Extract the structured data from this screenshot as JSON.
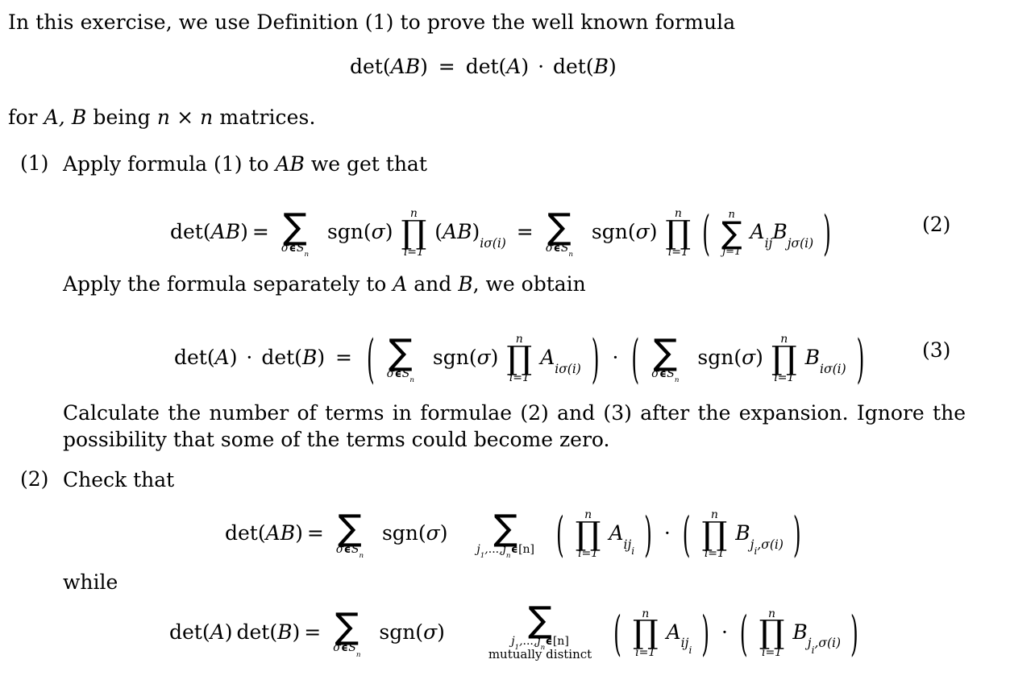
{
  "document": {
    "intro": {
      "line1": "In this exercise, we use Definition (1) to prove the well known formula",
      "display_formula": "det(AB) = det(A) · det(B)",
      "line2_prefix": "for ",
      "line2_vars": "A, B",
      "line2_mid": " being ",
      "line2_dims": "n × n",
      "line2_suffix": " matrices."
    },
    "items": [
      {
        "marker": "(1)",
        "text": "Apply formula (1) to AB we get that",
        "text_prefix": "Apply formula (1) to ",
        "text_math": "AB",
        "text_suffix": " we get that",
        "equation_number": "(2)",
        "equation_latex": "det(AB) = \\sum_{\\sigma \\in S_n} sgn(\\sigma) \\prod_{i=1}^{n} (AB)_{i\\sigma(i)} = \\sum_{\\sigma \\in S_n} sgn(\\sigma) \\prod_{i=1}^{n} \\left( \\sum_{j=1}^{n} A_{ij} B_{j\\sigma(i)} \\right)",
        "sub_text_prefix": "Apply the formula separately to ",
        "sub_text_a": "A",
        "sub_text_mid": " and ",
        "sub_text_b": "B",
        "sub_text_suffix": ", we obtain",
        "equation_number_2": "(3)",
        "equation_latex_2": "det(A) \\cdot det(B) = \\left( \\sum_{\\sigma \\in S_n} sgn(\\sigma) \\prod_{i=1}^{n} A_{i\\sigma(i)} \\right) \\cdot \\left( \\sum_{\\sigma \\in S_n} sgn(\\sigma) \\prod_{i=1}^{n} B_{i\\sigma(i)} \\right)",
        "closing_paragraph": "Calculate the number of terms in formulae (2) and (3) after the expansion. Ignore the possibility that some of the terms could become zero."
      },
      {
        "marker": "(2)",
        "text": "Check that",
        "equation_latex": "det(AB) = \\sum_{\\sigma \\in S_n} sgn(\\sigma) \\sum_{j_1,\\ldots,j_n \\in [n]} \\left( \\prod_{i=1}^{n} A_{ij_i} \\right) \\cdot \\left( \\prod_{i=1}^{n} B_{j_i,\\sigma(i)} \\right)",
        "connector": "while",
        "equation_latex_2": "det(A) det(B) = \\sum_{\\sigma \\in S_n} sgn(\\sigma) \\sum_{\\substack{j_1,\\ldots,j_n \\in [n] \\\\ mutually\\ distinct}} \\left( \\prod_{i=1}^{n} A_{ij_i} \\right) \\cdot \\left( \\prod_{i=1}^{n} B_{j_i,\\sigma(i)} \\right)"
      }
    ],
    "symbols": {
      "det": "det",
      "sgn": "sgn",
      "sigma": "σ",
      "sum": "∑",
      "prod": "∏",
      "elem_of": "ϵ",
      "cdot": "·",
      "times": "×",
      "ellipsis": "...",
      "S_n": "S",
      "n": "n",
      "i": "i",
      "j": "j",
      "A": "A",
      "B": "B",
      "one": "1",
      "i_eq_1": "i=1",
      "j_eq_1": "j=1",
      "mutually_distinct": "mutually distinct",
      "bracket_n": "[n]",
      "j1": "j",
      "jn": "j"
    },
    "labels": {
      "eq2": "(2)",
      "eq3": "(3)"
    },
    "colors": {
      "text": "#000000",
      "background": "#ffffff"
    }
  }
}
